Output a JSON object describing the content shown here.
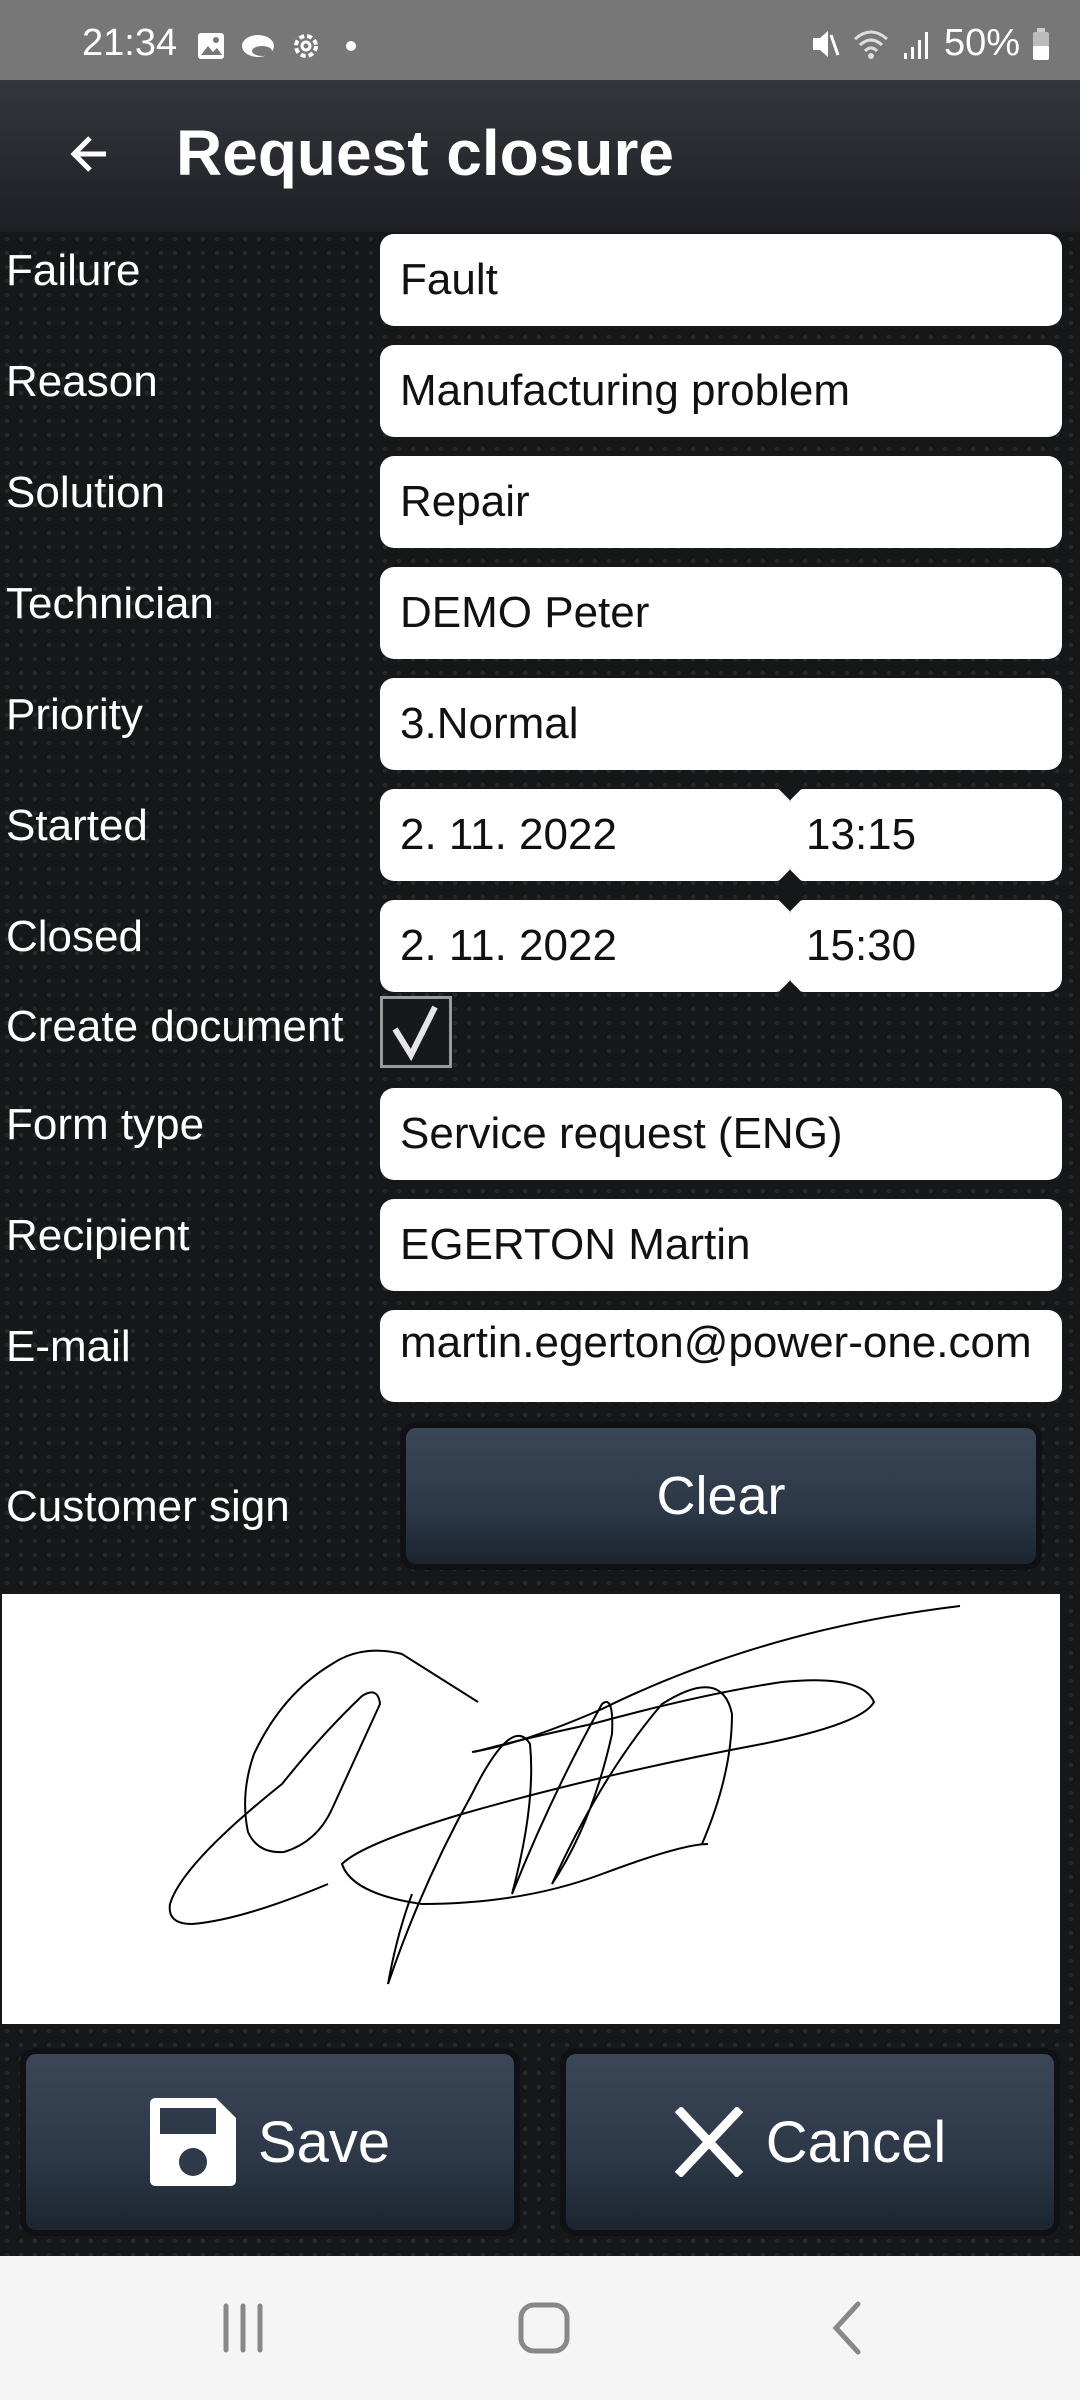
{
  "status_bar": {
    "time": "21:34",
    "battery": "50%",
    "icons_left": [
      "gallery-icon",
      "cloud-icon",
      "settings-icon",
      "dot-icon"
    ],
    "icons_right": [
      "mute-icon",
      "wifi-icon",
      "signal-icon",
      "battery-icon"
    ]
  },
  "app_bar": {
    "title": "Request closure",
    "back_icon": "arrow-left-icon"
  },
  "form": {
    "failure": {
      "label": "Failure",
      "value": "Fault"
    },
    "reason": {
      "label": "Reason",
      "value": "Manufacturing problem"
    },
    "solution": {
      "label": "Solution",
      "value": "Repair"
    },
    "technician": {
      "label": "Technician",
      "value": "DEMO Peter"
    },
    "priority": {
      "label": "Priority",
      "value": "3.Normal"
    },
    "started": {
      "label": "Started",
      "date": "2. 11. 2022",
      "time": "13:15"
    },
    "closed": {
      "label": "Closed",
      "date": "2. 11. 2022",
      "time": "15:30"
    },
    "create_document": {
      "label": "Create document",
      "checked": true
    },
    "form_type": {
      "label": "Form type",
      "value": "Service request (ENG)"
    },
    "recipient": {
      "label": "Recipient",
      "value": "EGERTON Martin"
    },
    "email": {
      "label": "E-mail",
      "value": "martin.egerton@power-one.com"
    },
    "customer_sign": {
      "label": "Customer sign",
      "clear_label": "Clear"
    }
  },
  "actions": {
    "save_label": "Save",
    "cancel_label": "Cancel"
  },
  "nav_bar": {
    "icons": [
      "recent-apps-icon",
      "home-icon",
      "back-icon"
    ]
  }
}
